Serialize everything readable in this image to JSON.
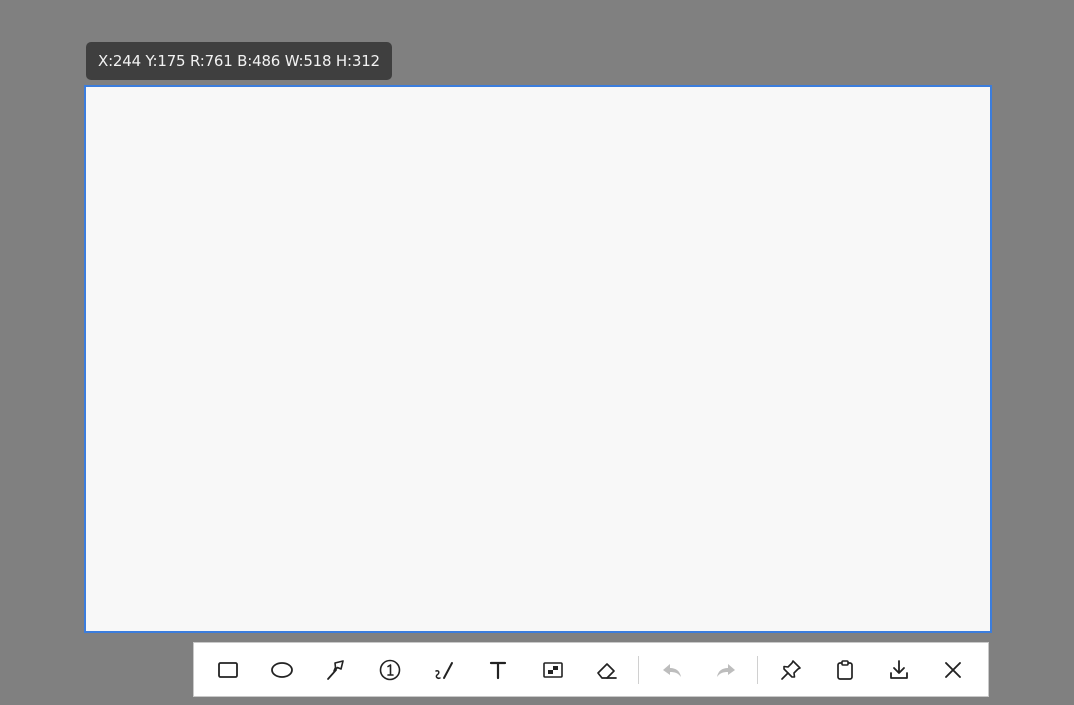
{
  "selection_info": {
    "text": "X:244 Y:175 R:761 B:486 W:518 H:312"
  },
  "colors": {
    "overlay": "#808080",
    "selection_border": "#3b7ddd",
    "selection_fill": "#f8f8f8",
    "label_bg": "#3f3f3f",
    "icon": "#222222",
    "icon_disabled": "#bdbdbd"
  },
  "toolbar": {
    "tools": [
      {
        "name": "rectangle",
        "icon": "rectangle-icon",
        "enabled": true
      },
      {
        "name": "ellipse",
        "icon": "ellipse-icon",
        "enabled": true
      },
      {
        "name": "arrow",
        "icon": "arrow-icon",
        "enabled": true
      },
      {
        "name": "number",
        "icon": "numbered-circle-icon",
        "enabled": true
      },
      {
        "name": "pen",
        "icon": "pen-icon",
        "enabled": true
      },
      {
        "name": "text",
        "icon": "text-icon",
        "enabled": true
      },
      {
        "name": "mosaic",
        "icon": "mosaic-icon",
        "enabled": true
      },
      {
        "name": "eraser",
        "icon": "eraser-icon",
        "enabled": true
      },
      {
        "name": "undo",
        "icon": "undo-icon",
        "enabled": false
      },
      {
        "name": "redo",
        "icon": "redo-icon",
        "enabled": false
      },
      {
        "name": "pin",
        "icon": "pin-icon",
        "enabled": true
      },
      {
        "name": "copy",
        "icon": "clipboard-icon",
        "enabled": true
      },
      {
        "name": "save",
        "icon": "download-icon",
        "enabled": true
      },
      {
        "name": "close",
        "icon": "close-icon",
        "enabled": true
      }
    ]
  }
}
